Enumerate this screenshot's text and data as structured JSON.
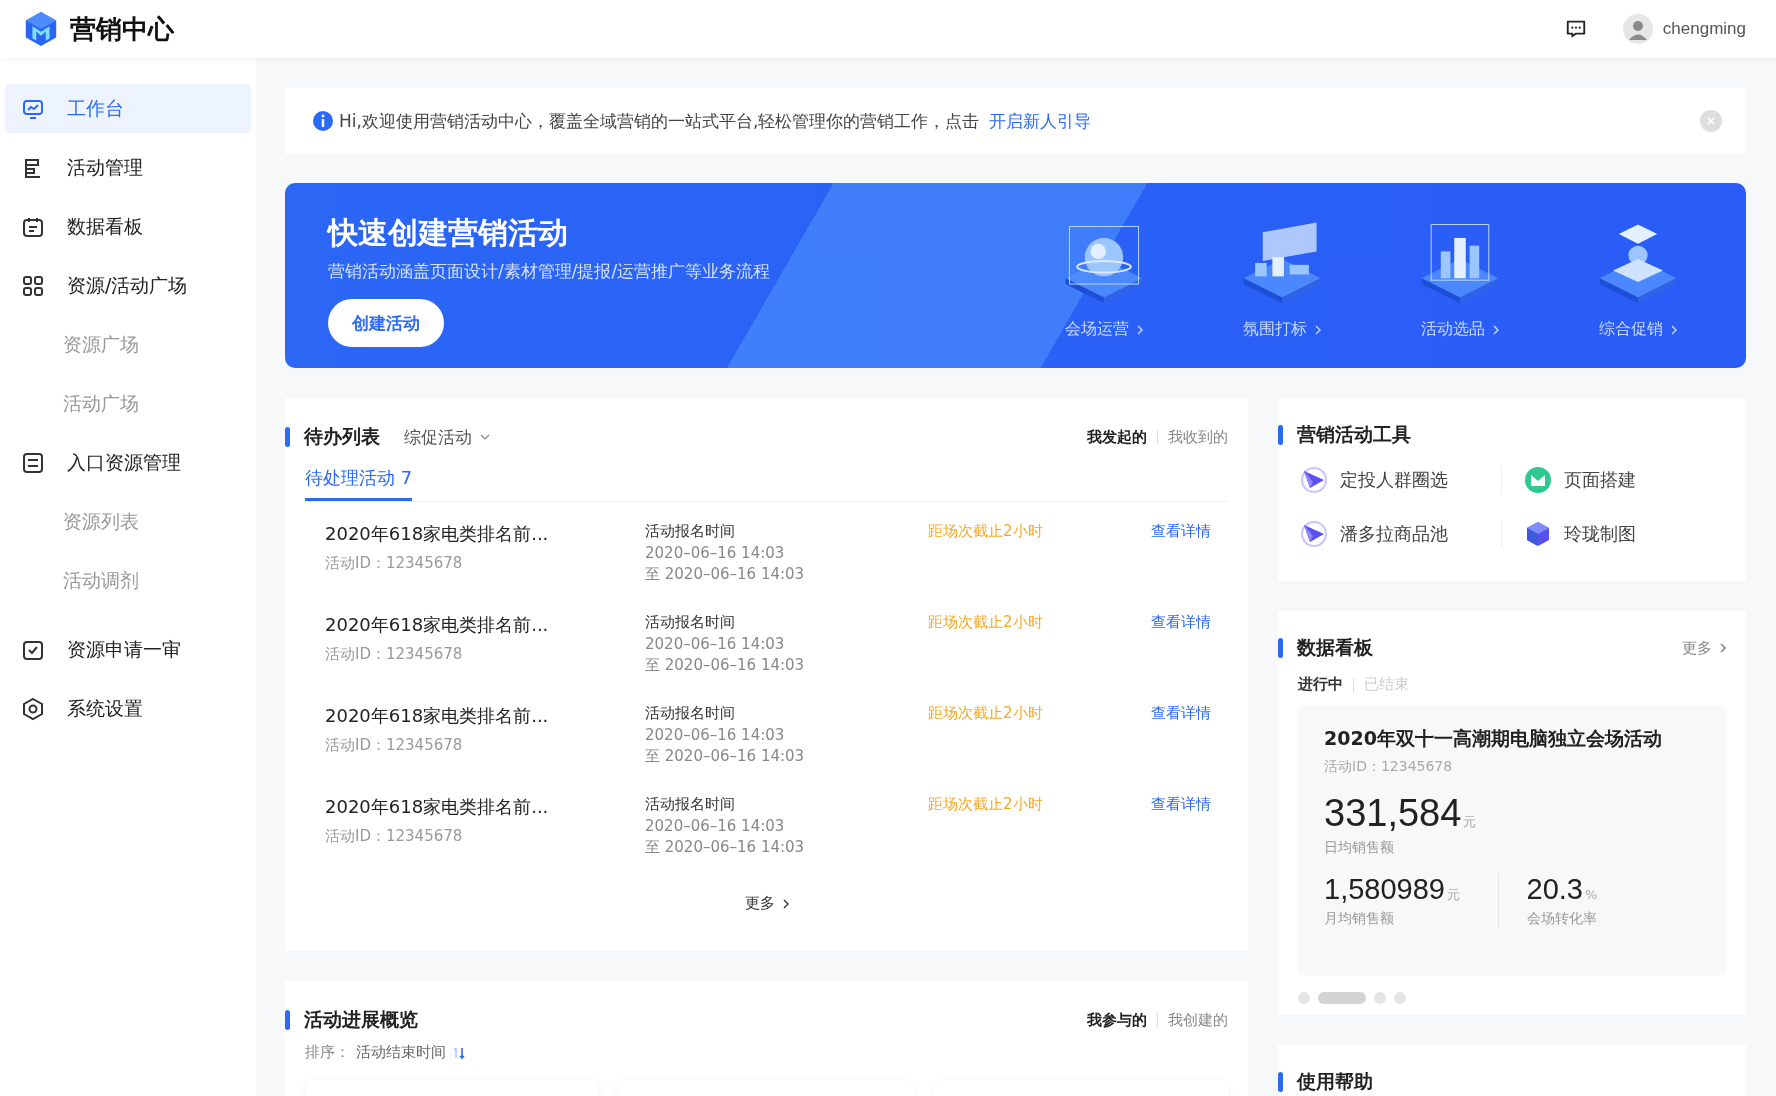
{
  "header": {
    "title": "营销中心",
    "user": "chengming"
  },
  "sidebar": {
    "items": [
      {
        "label": "工作台",
        "selected": true
      },
      {
        "label": "活动管理",
        "selected": false
      },
      {
        "label": "数据看板",
        "selected": false
      },
      {
        "label": "资源/活动广场",
        "selected": false,
        "children": [
          {
            "label": "资源广场",
            "selected": false
          },
          {
            "label": "活动广场",
            "selected": false
          }
        ]
      },
      {
        "label": "入口资源管理",
        "selected": false,
        "children": [
          {
            "label": "资源列表",
            "selected": false
          },
          {
            "label": "活动调剂",
            "selected": false
          }
        ]
      },
      {
        "label": "资源申请一审",
        "selected": false
      },
      {
        "label": "系统设置",
        "selected": false
      }
    ]
  },
  "notice": {
    "text": "Hi,欢迎使用营销活动中心，覆盖全域营销的一站式平台,轻松管理你的营销工作，点击",
    "link": "开启新人引导"
  },
  "banner": {
    "title": "快速创建营销活动",
    "subtitle": "营销活动涵盖页面设计/素材管理/提报/运营推广等业务流程",
    "button": "创建活动",
    "shortcuts": [
      {
        "label": "会场运营",
        "kind": "sphere"
      },
      {
        "label": "氛围打标",
        "kind": "stage"
      },
      {
        "label": "活动选品",
        "kind": "bars"
      },
      {
        "label": "综合促销",
        "kind": "podium"
      }
    ]
  },
  "todo": {
    "title": "待办列表",
    "filter": "综促活动",
    "scopes": [
      {
        "label": "我发起的",
        "selected": true
      },
      {
        "label": "我收到的",
        "selected": false
      }
    ],
    "tabs": [
      {
        "label": "待处理活动 7",
        "selected": true
      }
    ],
    "rows": [
      {
        "name": "2020年618家电类排名前...",
        "id": "活动ID：12345678",
        "time_label": "活动报名时间",
        "start": "2020–06–16 14:03",
        "end": "至 2020–06–16 14:03",
        "deadline": "距场次截止2小时",
        "action": "查看详情"
      },
      {
        "name": "2020年618家电类排名前...",
        "id": "活动ID：12345678",
        "time_label": "活动报名时间",
        "start": "2020–06–16 14:03",
        "end": "至 2020–06–16 14:03",
        "deadline": "距场次截止2小时",
        "action": "查看详情"
      },
      {
        "name": "2020年618家电类排名前...",
        "id": "活动ID：12345678",
        "time_label": "活动报名时间",
        "start": "2020–06–16 14:03",
        "end": "至 2020–06–16 14:03",
        "deadline": "距场次截止2小时",
        "action": "查看详情"
      },
      {
        "name": "2020年618家电类排名前...",
        "id": "活动ID：12345678",
        "time_label": "活动报名时间",
        "start": "2020–06–16 14:03",
        "end": "至 2020–06–16 14:03",
        "deadline": "距场次截止2小时",
        "action": "查看详情"
      }
    ],
    "more": "更多"
  },
  "overview": {
    "title": "活动进展概览",
    "scopes": [
      {
        "label": "我参与的",
        "selected": true
      },
      {
        "label": "我创建的",
        "selected": false
      }
    ],
    "sort_label": "排序：",
    "sort_value": "活动结束时间"
  },
  "tools": {
    "title": "营销活动工具",
    "items": [
      {
        "label": "定投人群圈选",
        "kind": "plane"
      },
      {
        "label": "页面搭建",
        "kind": "page"
      },
      {
        "label": "潘多拉商品池",
        "kind": "plane"
      },
      {
        "label": "玲珑制图",
        "kind": "cube"
      }
    ]
  },
  "dashboard": {
    "title": "数据看板",
    "more": "更多",
    "tabs": [
      {
        "label": "进行中",
        "selected": true
      },
      {
        "label": "已结束",
        "selected": false
      }
    ],
    "card": {
      "name": "2020年双十一高潮期电脑独立会场活动",
      "id": "活动ID：12345678",
      "value": "331,584",
      "unit": "元",
      "label": "日均销售额",
      "stats": [
        {
          "value": "1,580989",
          "unit": "元",
          "label": "月均销售额"
        },
        {
          "value": "20.3",
          "unit": "%",
          "label": "会场转化率"
        }
      ]
    },
    "pager": [
      {
        "selected": false
      },
      {
        "selected": true
      },
      {
        "selected": false
      },
      {
        "selected": false
      }
    ]
  },
  "help": {
    "title": "使用帮助"
  }
}
